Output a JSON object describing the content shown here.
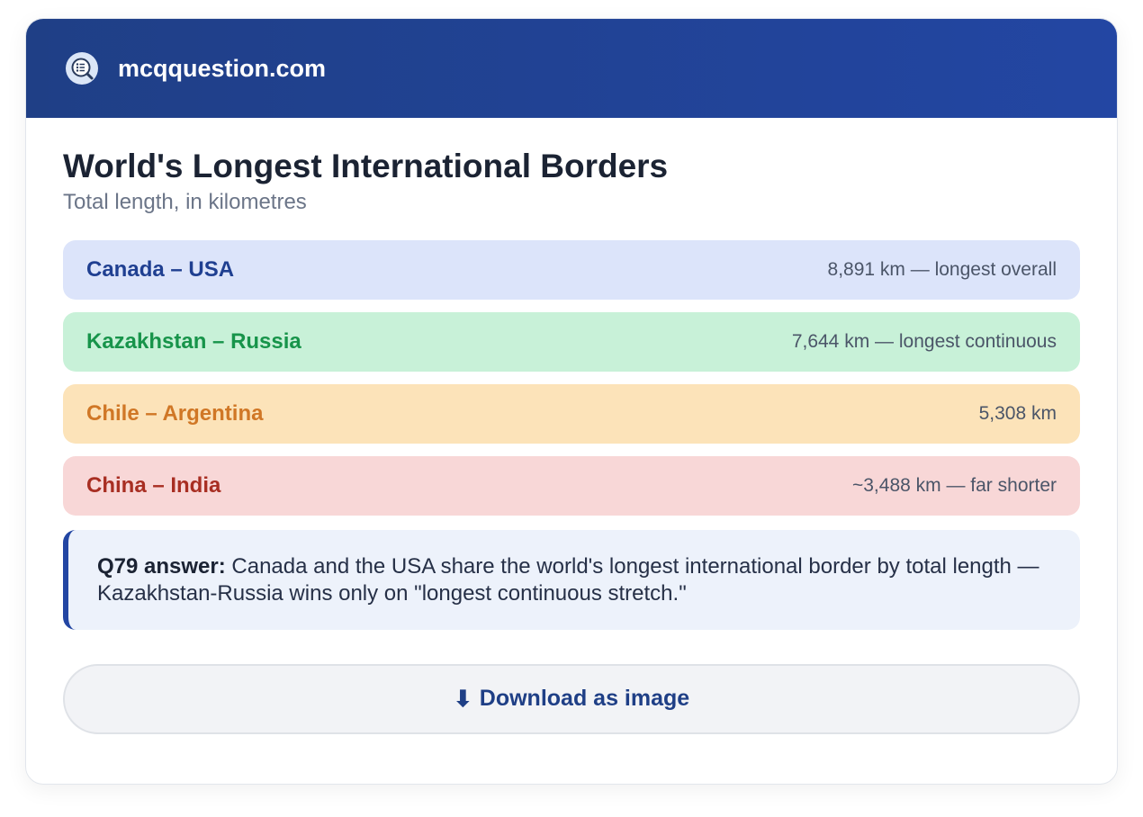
{
  "header": {
    "site_name": "mcqquestion.com",
    "logo_icon": "magnifier-checklist-icon"
  },
  "main": {
    "title": "World's Longest International Borders",
    "subtitle": "Total length, in kilometres",
    "borders": [
      {
        "name": "Canada – USA",
        "detail": "8,891 km — longest overall",
        "bg": "#dce4fa",
        "color": "#1f3f91"
      },
      {
        "name": "Kazakhstan – Russia",
        "detail": "7,644 km — longest continuous",
        "bg": "#c8f1d8",
        "color": "#17944a"
      },
      {
        "name": "Chile – Argentina",
        "detail": "5,308 km",
        "bg": "#fce3b9",
        "color": "#d07726"
      },
      {
        "name": "China – India",
        "detail": "~3,488 km — far shorter",
        "bg": "#f8d7d7",
        "color": "#a82e22"
      }
    ],
    "answer": {
      "label": "Q79 answer:",
      "text": " Canada and the USA share the world's longest international border by total length — Kazakhstan-Russia wins only on \"longest continuous stretch.\""
    },
    "download": {
      "icon": "⬇",
      "label": "Download as image"
    }
  },
  "colors": {
    "header_start": "#1f3f86",
    "header_end": "#2346a3",
    "accent": "#2346a3"
  }
}
